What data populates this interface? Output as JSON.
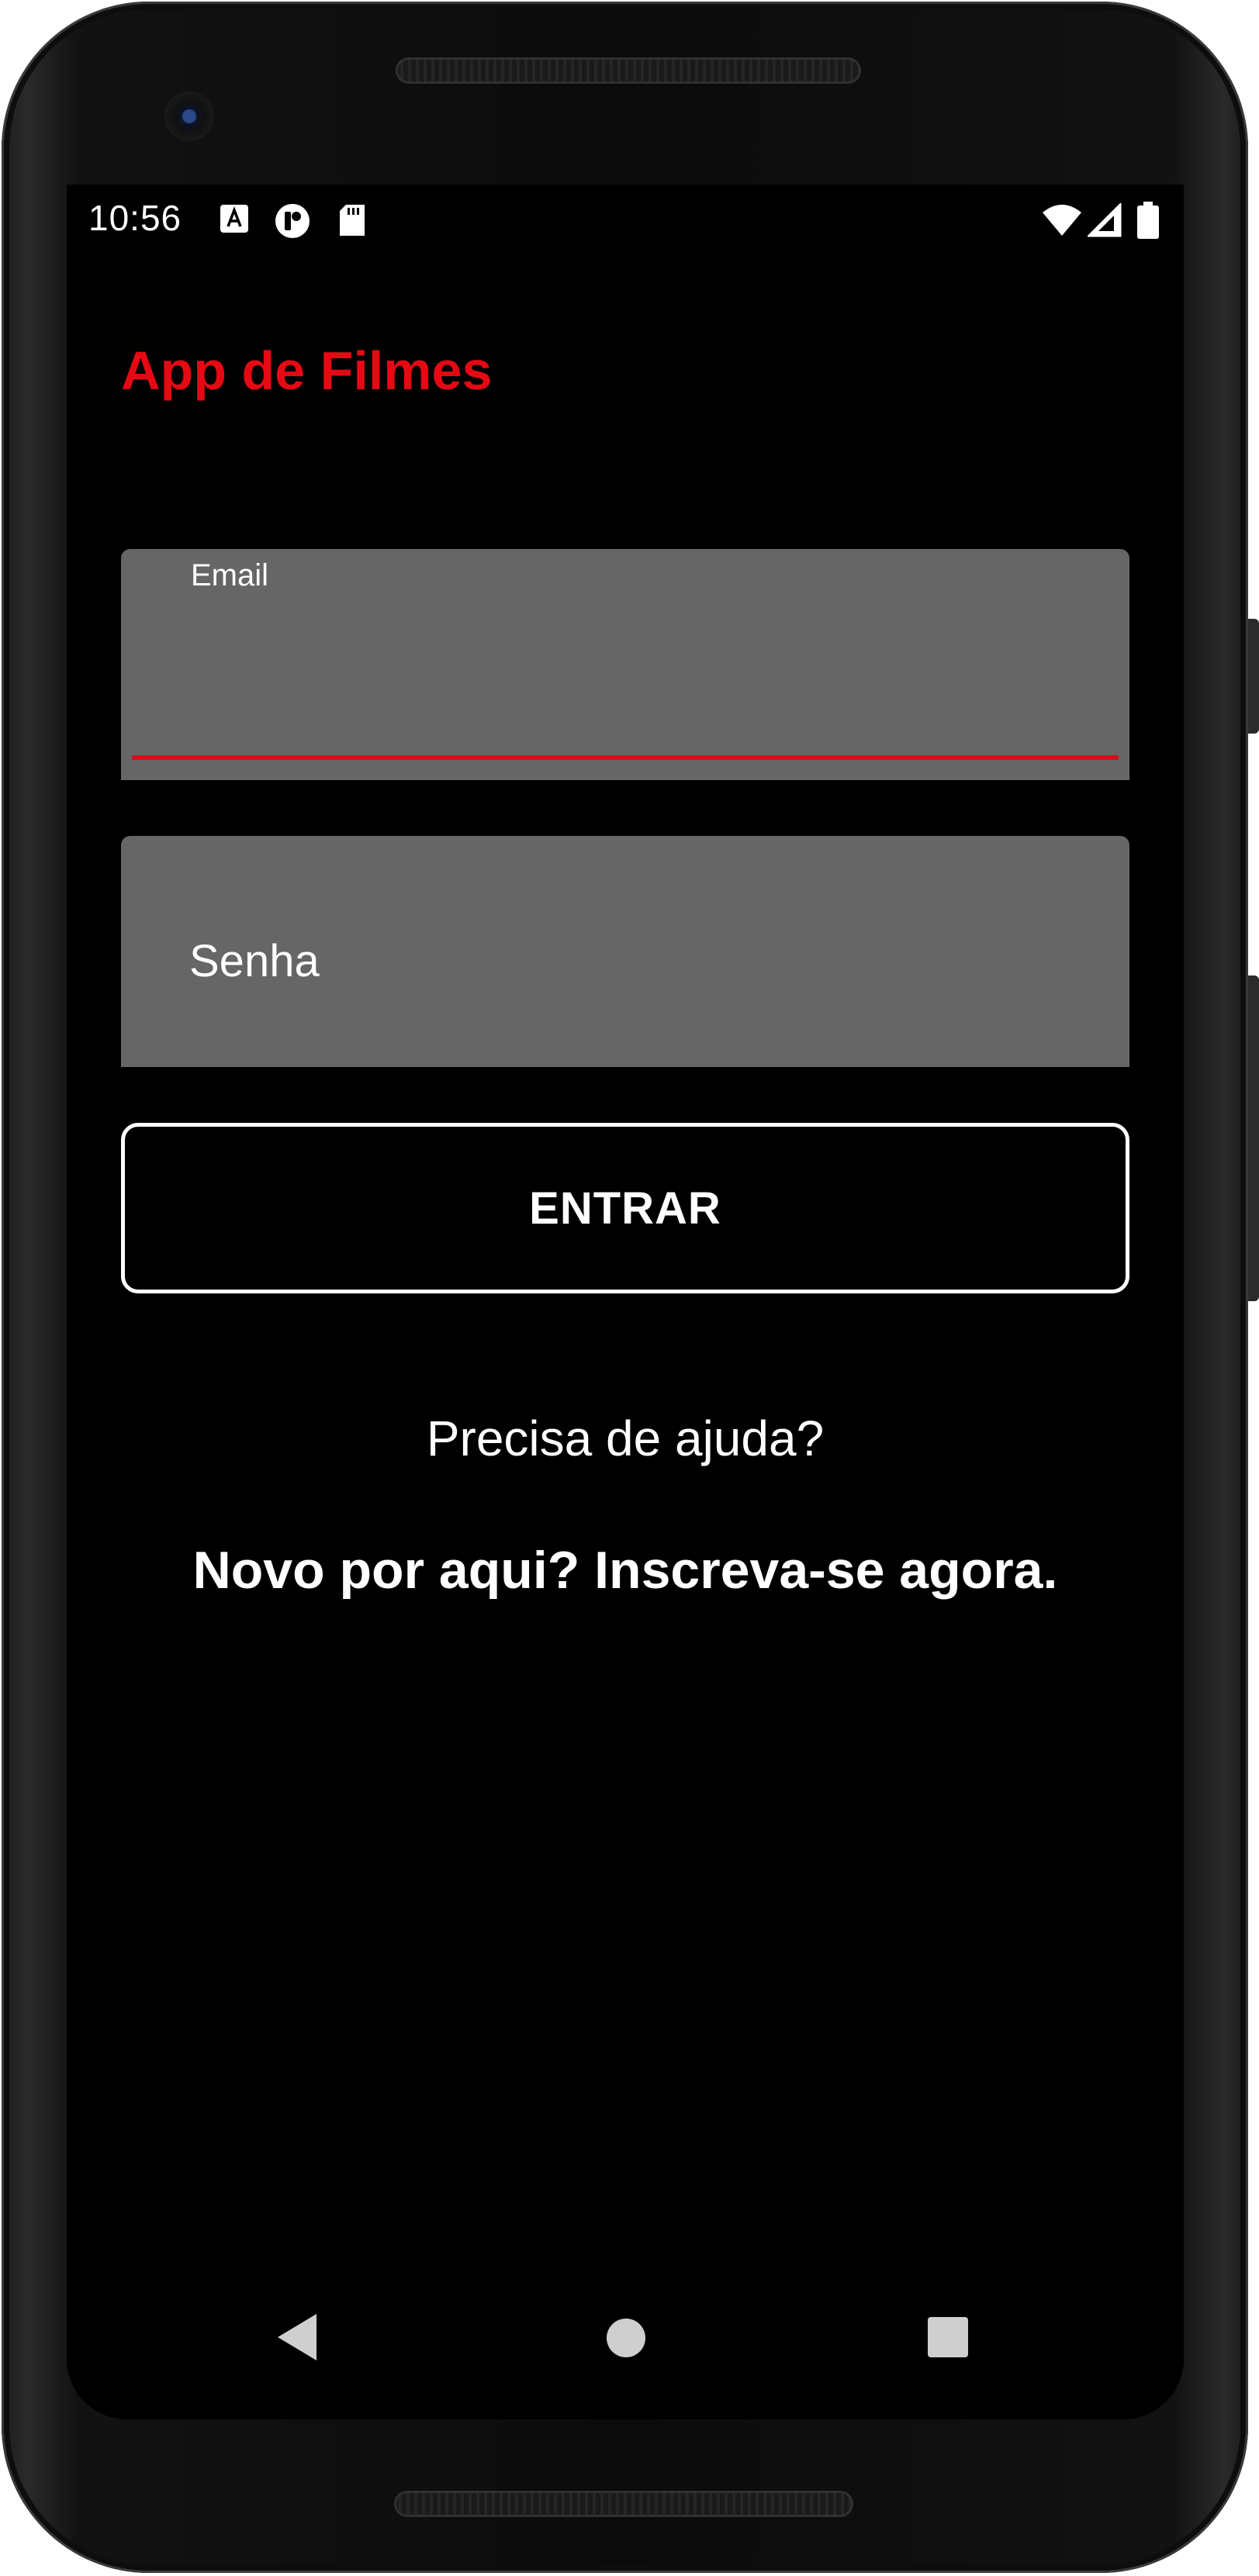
{
  "status_bar": {
    "time": "10:56",
    "left_icons": [
      "accessibility-icon",
      "notification-icon",
      "sd-card-icon"
    ],
    "right_icons": [
      "wifi-icon",
      "cell-signal-icon",
      "battery-icon"
    ]
  },
  "app": {
    "title": "App de Filmes",
    "accent_color": "#e50914"
  },
  "form": {
    "email_label": "Email",
    "email_value": "",
    "password_placeholder": "Senha",
    "submit_label": "ENTRAR"
  },
  "links": {
    "help": "Precisa de ajuda?",
    "signup": "Novo por aqui? Inscreva-se agora."
  },
  "nav_bar": {
    "buttons": [
      "back-icon",
      "home-icon",
      "recents-icon"
    ]
  }
}
